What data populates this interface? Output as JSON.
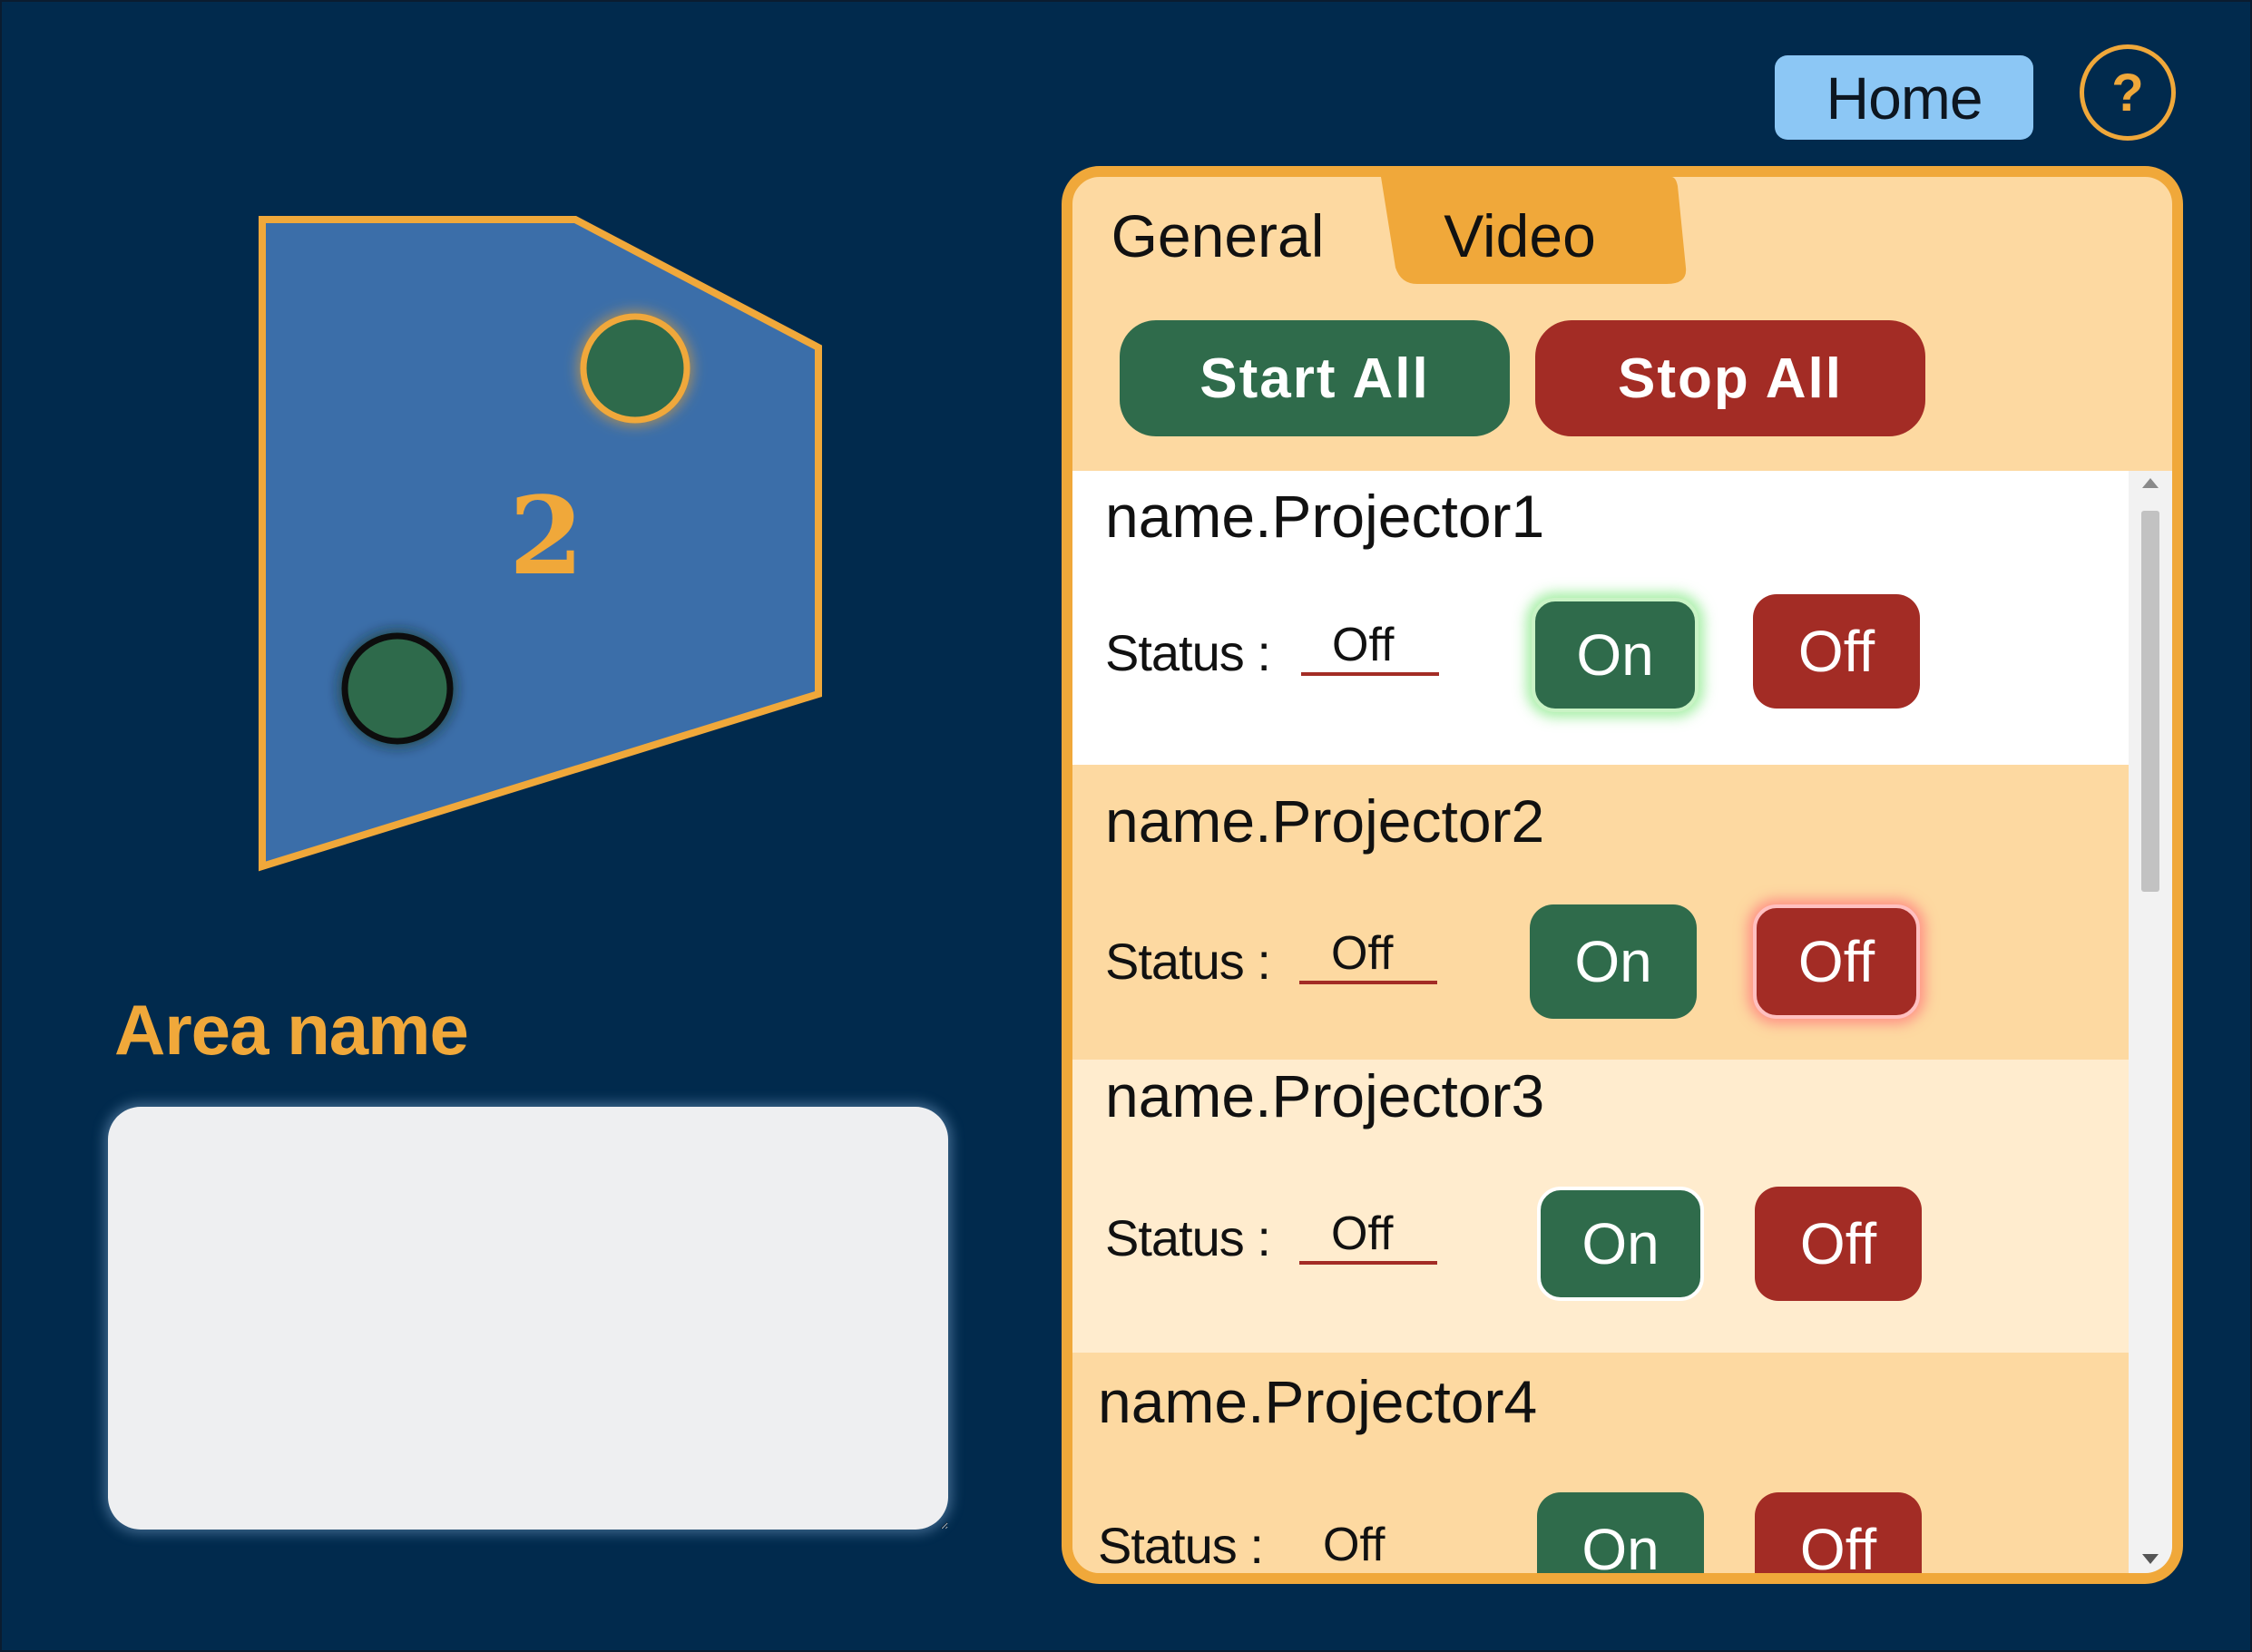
{
  "header": {
    "home_label": "Home",
    "help_label": "?"
  },
  "area": {
    "number": "2",
    "name_label": "Area name",
    "name_value": ""
  },
  "tabs": [
    {
      "label": "General",
      "selected": false
    },
    {
      "label": "Video",
      "selected": true
    }
  ],
  "controls": {
    "start_all": "Start All",
    "stop_all": "Stop All"
  },
  "projectors": [
    {
      "name": "name.Projector1",
      "status_label": "Status :",
      "status": "Off",
      "on_label": "On",
      "off_label": "Off",
      "highlight": "on"
    },
    {
      "name": "name.Projector2",
      "status_label": "Status :",
      "status": "Off",
      "on_label": "On",
      "off_label": "Off",
      "highlight": "off"
    },
    {
      "name": "name.Projector3",
      "status_label": "Status :",
      "status": "Off",
      "on_label": "On",
      "off_label": "Off",
      "highlight": "none"
    },
    {
      "name": "name.Projector4",
      "status_label": "Status :",
      "status": "Off",
      "on_label": "On",
      "off_label": "Off",
      "highlight": "none"
    }
  ],
  "colors": {
    "background": "#012a4d",
    "accent": "#f0a83a",
    "panel": "#fdd9a1",
    "on_green": "#2f6b4b",
    "off_red": "#a32c25",
    "home_blue": "#8cc7f5",
    "area_fill": "#3b6ea9"
  }
}
